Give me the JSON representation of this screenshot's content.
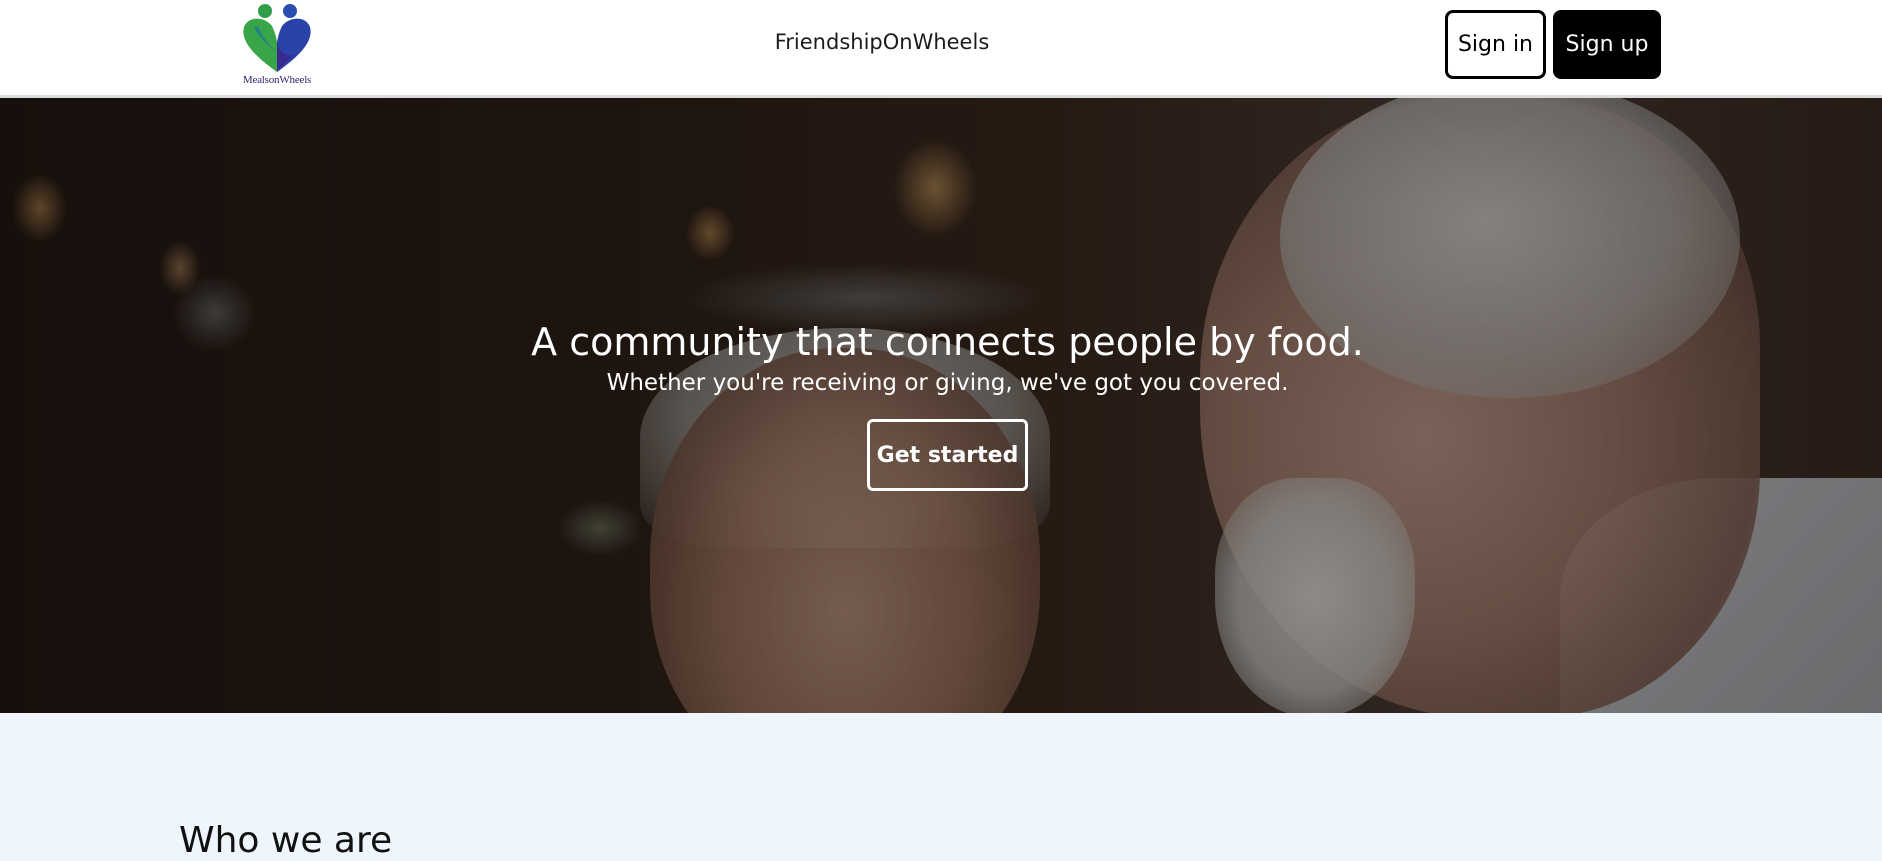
{
  "header": {
    "logo_text": "MealsonWheels",
    "brand": "FriendshipOnWheels",
    "sign_in_label": "Sign in",
    "sign_up_label": "Sign up"
  },
  "hero": {
    "title": "A community that connects people by food.",
    "subtitle": "Whether you're receiving or giving, we've got you covered.",
    "cta_label": "Get started"
  },
  "about": {
    "title": "Who we are"
  },
  "colors": {
    "primary_button": "#000000",
    "page_background": "#eef5fd",
    "logo_green": "#3aa83a",
    "logo_blue": "#2a6fd1",
    "logo_purple": "#3b2a8f"
  },
  "icons": {
    "logo": "heart-people-logo-icon"
  }
}
